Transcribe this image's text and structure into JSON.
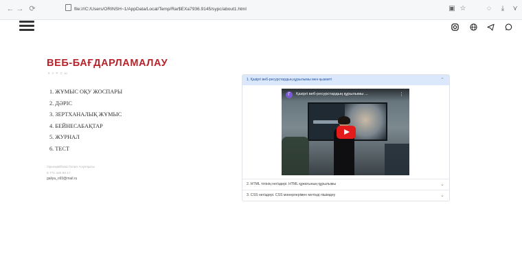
{
  "browser": {
    "url": "file:///C:/Users/ORINSH~1/AppData/Local/Temp/Rar$EXa7936.9145/sypc/about1.html",
    "back_glyph": "←",
    "forward_glyph": "→",
    "reload_glyph": "⟳",
    "icons": [
      "reader-mode-icon",
      "bookmark-icon",
      "shield-icon",
      "download-icon",
      "profile-icon"
    ]
  },
  "header": {
    "menu_icon": "hamburger-icon",
    "social_icons": [
      "instagram-icon",
      "globe-icon",
      "telegram-icon",
      "whatsapp-icon"
    ]
  },
  "site": {
    "title": "ВЕБ-БАҒДАРЛАМАЛАУ",
    "subtitle": "КУРСЫ"
  },
  "menu": {
    "items": [
      "1. ЖҰМЫС ОҚУ ЖОСПАРЫ",
      "2. ДӘРІС",
      "3. ЗЕРТХАНАЛЫҚ ЖҰМЫС",
      "4. БЕЙНЕСАБАҚТАР",
      "5. ЖУРНАЛ",
      "6. ТЕСТ"
    ]
  },
  "author": {
    "name": "Орынқайбова Галия Асқатқызы",
    "phone": "8 771 420 90 17",
    "email": "galiya_o93@mail.ru"
  },
  "accordion": {
    "items": [
      {
        "title": "1. Қазіргі веб-ресурстардың құрылымы мен қызметі",
        "expanded": true
      },
      {
        "title": "2. HTML тілінің негіздері. HTML құжатының құрылымы",
        "expanded": false
      },
      {
        "title": "3. CSS негіздері. CSS мәнерлерімен мәтінді пішімдеу",
        "expanded": false
      }
    ]
  },
  "video": {
    "channel_initial": "Г",
    "title": "Қазіргі веб-ресурстардың құрылымы ...",
    "menu_glyph": "⋮"
  },
  "colors": {
    "title_red": "#b8222a",
    "accordion_active_bg": "#dbe8fb",
    "play_red": "#e31b1b"
  }
}
